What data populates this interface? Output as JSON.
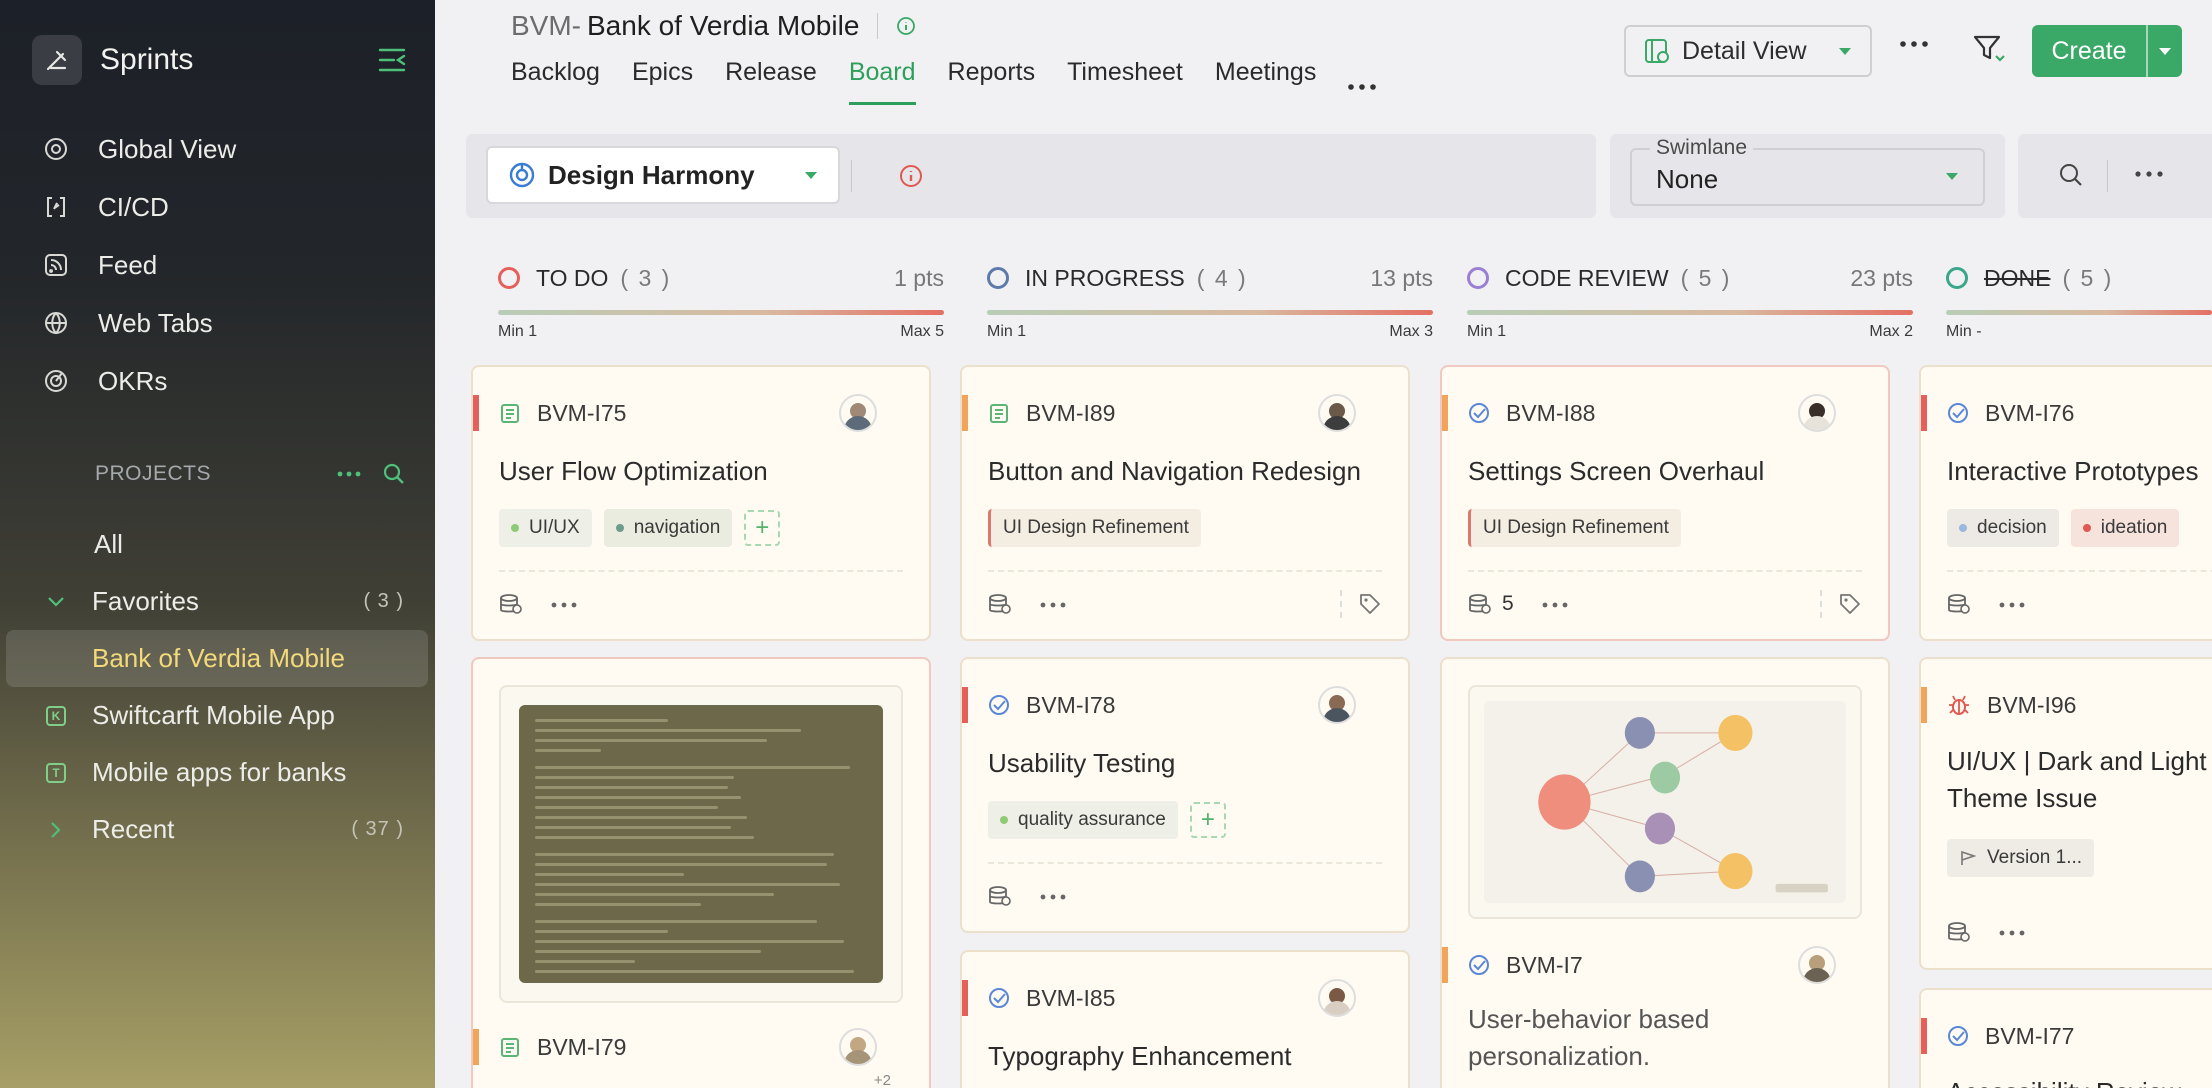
{
  "sidebar": {
    "app_title": "Sprints",
    "nav": [
      {
        "label": "Global View",
        "icon": "global-view-icon"
      },
      {
        "label": "CI/CD",
        "icon": "cicd-icon"
      },
      {
        "label": "Feed",
        "icon": "feed-icon"
      },
      {
        "label": "Web Tabs",
        "icon": "globe-icon"
      },
      {
        "label": "OKRs",
        "icon": "target-icon"
      }
    ],
    "projects_label": "PROJECTS",
    "all_label": "All",
    "favorites": {
      "label": "Favorites",
      "count": "( 3 )"
    },
    "projects": [
      {
        "label": "Bank of Verdia Mobile",
        "active": true
      },
      {
        "label": "Swiftcarft Mobile App",
        "badge": "K"
      },
      {
        "label": "Mobile apps for banks",
        "badge": "T"
      }
    ],
    "recent": {
      "label": "Recent",
      "count": "( 37 )"
    }
  },
  "header": {
    "project_prefix": "BVM-",
    "project_name": "Bank of Verdia Mobile",
    "tabs": [
      "Backlog",
      "Epics",
      "Release",
      "Board",
      "Reports",
      "Timesheet",
      "Meetings"
    ],
    "active_tab": "Board",
    "view_selector": "Detail View",
    "create_label": "Create"
  },
  "toolbar": {
    "sprint": "Design Harmony",
    "swimlane_label": "Swimlane",
    "swimlane_value": "None"
  },
  "columns": [
    {
      "name": "TO DO",
      "count": "( 3 )",
      "points": "1 pts",
      "min": "Min 1",
      "max": "Max 5",
      "color": "#e5605a"
    },
    {
      "name": "IN PROGRESS",
      "count": "( 4 )",
      "points": "13 pts",
      "min": "Min 1",
      "max": "Max 3",
      "color": "#5d7aa8"
    },
    {
      "name": "CODE REVIEW",
      "count": "( 5 )",
      "points": "23 pts",
      "min": "Min 1",
      "max": "Max 2",
      "color": "#9a7fd3"
    },
    {
      "name": "DONE",
      "count": "( 5 )",
      "points": "",
      "min": "Min -",
      "max": "",
      "color": "#3aa68a"
    }
  ],
  "cards": {
    "i75": {
      "id": "BVM-I75",
      "title": "User Flow Optimization",
      "tags": [
        "UI/UX",
        "navigation"
      ]
    },
    "i79": {
      "id": "BVM-I79",
      "avatar_extra": "+2"
    },
    "i89": {
      "id": "BVM-I89",
      "title": "Button and Navigation Redesign",
      "epic": "UI Design Refinement"
    },
    "i78": {
      "id": "BVM-I78",
      "title": "Usability Testing",
      "tags": [
        "quality assurance"
      ]
    },
    "i85": {
      "id": "BVM-I85",
      "title": "Typography Enhancement"
    },
    "i88": {
      "id": "BVM-I88",
      "title": "Settings Screen Overhaul",
      "epic": "UI Design Refinement",
      "points": "5"
    },
    "i7": {
      "id": "BVM-I7",
      "title": "User-behavior based personalization."
    },
    "i76": {
      "id": "BVM-I76",
      "title": "Interactive Prototypes",
      "tags": [
        "decision",
        "ideation"
      ]
    },
    "i96": {
      "id": "BVM-I96",
      "title": "UI/UX | Dark and Light Theme Issue",
      "version": "Version 1..."
    },
    "i77": {
      "id": "BVM-I77",
      "title": "Accessibility Review"
    }
  },
  "colors": {
    "accent": "#2e9f5b",
    "create": "#3aa866",
    "active_project": "#f3d97a"
  }
}
